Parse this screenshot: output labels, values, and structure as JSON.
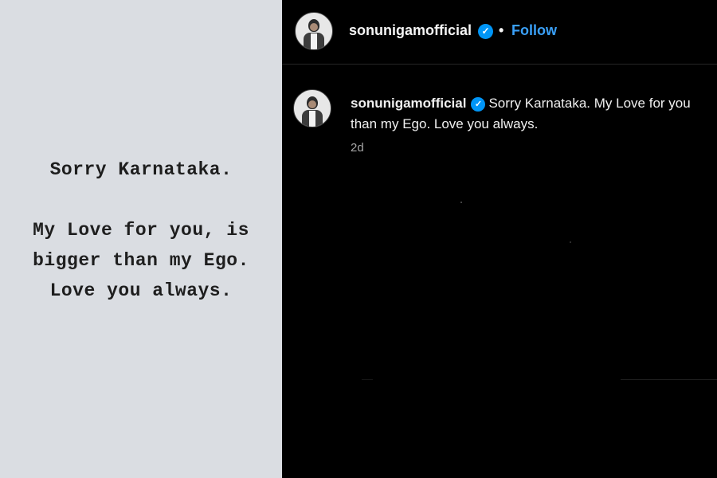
{
  "image_post": {
    "line1": "Sorry Karnataka.",
    "line2": "My Love for you, is",
    "line3": "bigger than my Ego.",
    "line4": "Love you always."
  },
  "header": {
    "username": "sonunigamofficial",
    "verified_icon": "verified-badge-icon",
    "separator": "•",
    "follow_label": "Follow"
  },
  "caption": {
    "username": "sonunigamofficial",
    "text_line1": "Sorry Karnataka. My Love for you",
    "text_line2": "than my Ego. Love you always.",
    "timestamp": "2d"
  },
  "colors": {
    "left_background": "#dadde2",
    "right_background": "#000000",
    "verified_blue": "#0095f6",
    "follow_blue": "#3aa0f8",
    "muted_text": "#a8a8a8"
  }
}
